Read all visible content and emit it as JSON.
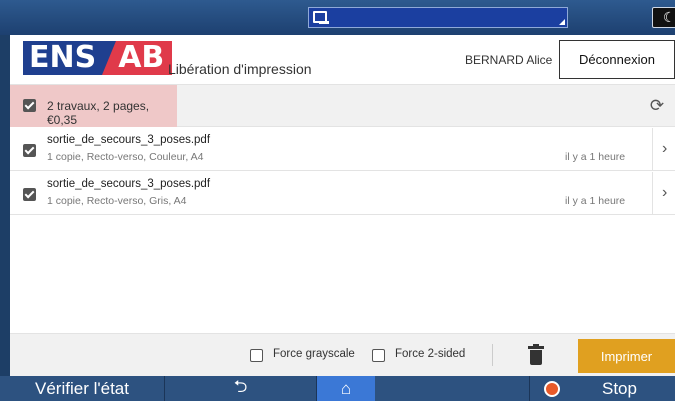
{
  "app": {
    "logo_left": "ENS",
    "logo_right": "AB",
    "title": "Libération d'impression",
    "user_name": "BERNARD Alice",
    "logout_label": "Déconnexion"
  },
  "summary": {
    "text": "2 travaux, 2 pages, €0,35",
    "checked": true,
    "refresh_icon": "refresh-icon"
  },
  "jobs": [
    {
      "name": "sortie_de_secours_3_poses.pdf",
      "description": "1 copie, Recto-verso, Couleur, A4",
      "time": "il y a 1 heure",
      "checked": true
    },
    {
      "name": "sortie_de_secours_3_poses.pdf",
      "description": "1 copie, Recto-verso, Gris, A4",
      "time": "il y a 1 heure",
      "checked": true
    }
  ],
  "footer": {
    "force_grayscale_label": "Force grayscale",
    "force_2sided_label": "Force 2-sided",
    "delete_icon": "trash-icon",
    "print_label": "Imprimer"
  },
  "device_bar": {
    "check_status_label": "Vérifier l'état",
    "back_icon": "back-arrow-icon",
    "home_icon": "home-icon",
    "stop_label": "Stop"
  },
  "colors": {
    "accent_print": "#e0a020",
    "logo_blue": "#1f3f8f",
    "logo_red": "#e03a4a",
    "summary_highlight": "#efc8c8"
  }
}
